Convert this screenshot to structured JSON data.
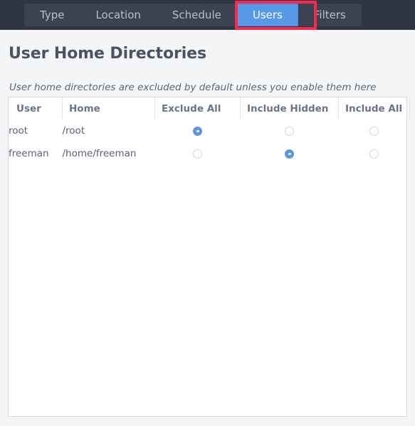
{
  "tabs": [
    {
      "label": "Type",
      "selected": false
    },
    {
      "label": "Location",
      "selected": false
    },
    {
      "label": "Schedule",
      "selected": false
    },
    {
      "label": "Users",
      "selected": true
    },
    {
      "label": "Filters",
      "selected": false
    }
  ],
  "page": {
    "title": "User Home Directories",
    "subtitle": "User home directories are excluded by default unless you enable them here"
  },
  "table": {
    "headers": {
      "user": "User",
      "home": "Home",
      "exclude_all": "Exclude All",
      "include_hidden": "Include Hidden",
      "include_all": "Include All"
    },
    "rows": [
      {
        "user": "root",
        "home": "/root",
        "exclude_all": true,
        "include_hidden": false,
        "include_all": false
      },
      {
        "user": "freeman",
        "home": "/home/freeman",
        "exclude_all": false,
        "include_hidden": true,
        "include_all": false
      }
    ]
  },
  "colors": {
    "tabbar_bg": "#2f3542",
    "tabstrip_bg": "#3b4252",
    "tab_selected_bg": "#5599e8",
    "tab_text": "#b9bfcb",
    "highlight_border": "#f8294b",
    "radio_checked": "#5b96e5",
    "panel_bg": "#ffffff",
    "page_bg": "#f4f5f7",
    "heading_text": "#4a5263"
  },
  "annotation": {
    "target": "Users",
    "type": "red-rectangle-highlight"
  }
}
